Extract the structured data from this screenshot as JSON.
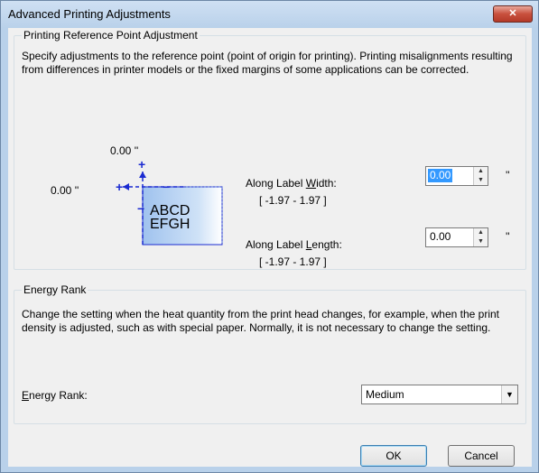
{
  "window": {
    "title": "Advanced Printing Adjustments",
    "close_label": "✕"
  },
  "reference_group": {
    "legend": "Printing Reference Point Adjustment",
    "description": "Specify adjustments to the reference point (point of origin for printing). Printing misalignments resulting from differences in printer models or the fixed margins of some applications can be corrected.",
    "diagram": {
      "top_value": "0.00 ''",
      "left_value": "0.00 ''",
      "sample_line1": "ABCD",
      "sample_line2": "EFGH"
    },
    "width_field": {
      "label_pre": "Along Label ",
      "label_mnemonic": "W",
      "label_post": "idth:",
      "value": "0.00",
      "unit": "''",
      "range": "[ -1.97 - 1.97 ]"
    },
    "length_field": {
      "label_pre": "Along Label ",
      "label_mnemonic": "L",
      "label_post": "ength:",
      "value": "0.00",
      "unit": "''",
      "range": "[ -1.97 - 1.97 ]"
    }
  },
  "energy_group": {
    "legend": "Energy Rank",
    "description": "Change the setting when the heat quantity from the print head changes, for example, when the print density is adjusted, such as with special paper. Normally, it is not necessary to change the setting.",
    "label_mnemonic": "E",
    "label_rest": "nergy Rank:",
    "selected": "Medium"
  },
  "buttons": {
    "ok": "OK",
    "cancel": "Cancel"
  },
  "colors": {
    "accent_blue": "#1b2bd1",
    "selection": "#3399ff"
  }
}
